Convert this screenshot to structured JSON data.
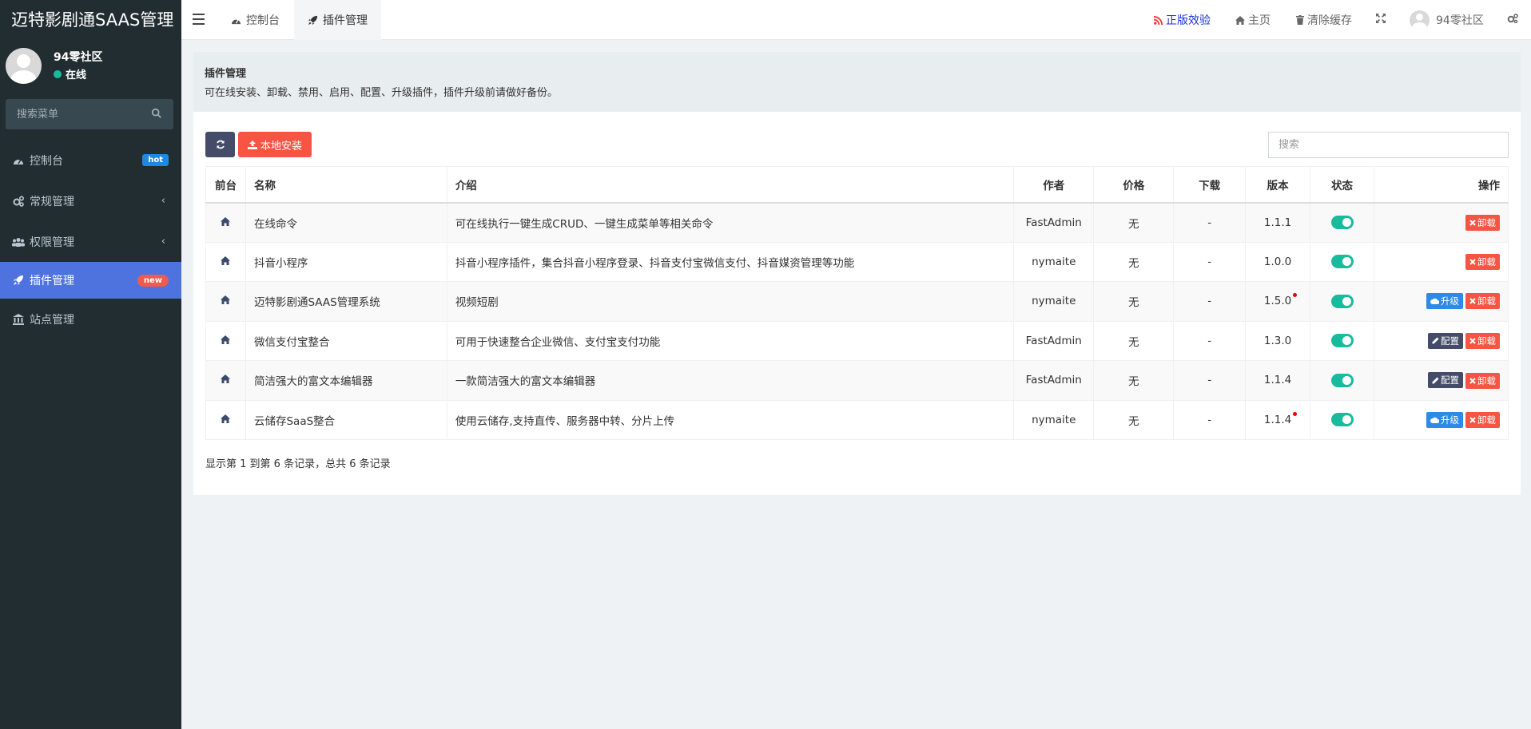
{
  "app": {
    "title": "迈特影剧通SAAS管理"
  },
  "user": {
    "name": "94零社区",
    "status": "在线"
  },
  "sidebar": {
    "search_placeholder": "搜索菜单",
    "items": [
      {
        "label": "控制台",
        "badge": "hot"
      },
      {
        "label": "常规管理"
      },
      {
        "label": "权限管理"
      },
      {
        "label": "插件管理",
        "badge": "new"
      },
      {
        "label": "站点管理"
      }
    ]
  },
  "navbar": {
    "tabs": [
      {
        "label": "控制台"
      },
      {
        "label": "插件管理"
      }
    ],
    "links": {
      "official": "正版效验",
      "home": "主页",
      "clear_cache": "清除缓存",
      "username": "94零社区"
    }
  },
  "panel": {
    "title": "插件管理",
    "desc": "可在线安装、卸载、禁用、启用、配置、升级插件，插件升级前请做好备份。"
  },
  "toolbar": {
    "local_install": "本地安装",
    "search_placeholder": "搜索"
  },
  "table": {
    "headers": {
      "front": "前台",
      "name": "名称",
      "intro": "介绍",
      "author": "作者",
      "price": "价格",
      "download": "下载",
      "version": "版本",
      "status": "状态",
      "actions": "操作"
    },
    "rows": [
      {
        "name": "在线命令",
        "intro": "可在线执行一键生成CRUD、一键生成菜单等相关命令",
        "author": "FastAdmin",
        "price": "无",
        "download": "-",
        "version": "1.1.1",
        "status": "on",
        "actions": [
          "卸载"
        ]
      },
      {
        "name": "抖音小程序",
        "intro": "抖音小程序插件，集合抖音小程序登录、抖音支付宝微信支付、抖音媒资管理等功能",
        "author": "nymaite",
        "price": "无",
        "download": "-",
        "version": "1.0.0",
        "status": "on",
        "actions": [
          "卸载"
        ]
      },
      {
        "name": "迈特影剧通SAAS管理系统",
        "intro": "视频短剧",
        "author": "nymaite",
        "price": "无",
        "download": "-",
        "version": "1.5.0",
        "status": "on",
        "actions": [
          "升级",
          "卸载"
        ]
      },
      {
        "name": "微信支付宝整合",
        "intro": "可用于快速整合企业微信、支付宝支付功能",
        "author": "FastAdmin",
        "price": "无",
        "download": "-",
        "version": "1.3.0",
        "status": "on",
        "actions": [
          "配置",
          "卸载"
        ]
      },
      {
        "name": "简洁强大的富文本编辑器",
        "intro": "一款简洁强大的富文本编辑器",
        "author": "FastAdmin",
        "price": "无",
        "download": "-",
        "version": "1.1.4",
        "status": "on",
        "actions": [
          "配置",
          "卸载"
        ]
      },
      {
        "name": "云储存SaaS整合",
        "intro": "使用云储存,支持直传、服务器中转、分片上传",
        "author": "nymaite",
        "price": "无",
        "download": "-",
        "version": "1.1.4",
        "status": "on",
        "actions": [
          "升级",
          "卸载"
        ]
      }
    ]
  },
  "pagination": {
    "text": "显示第 1 到第 6 条记录，总共 6 条记录"
  },
  "colors": {
    "sidebar_bg": "#222d32",
    "active_menu": "#4e73df",
    "danger": "#f75444",
    "primary": "#2d8ae6",
    "success": "#18bc9c",
    "dark": "#444c69"
  }
}
